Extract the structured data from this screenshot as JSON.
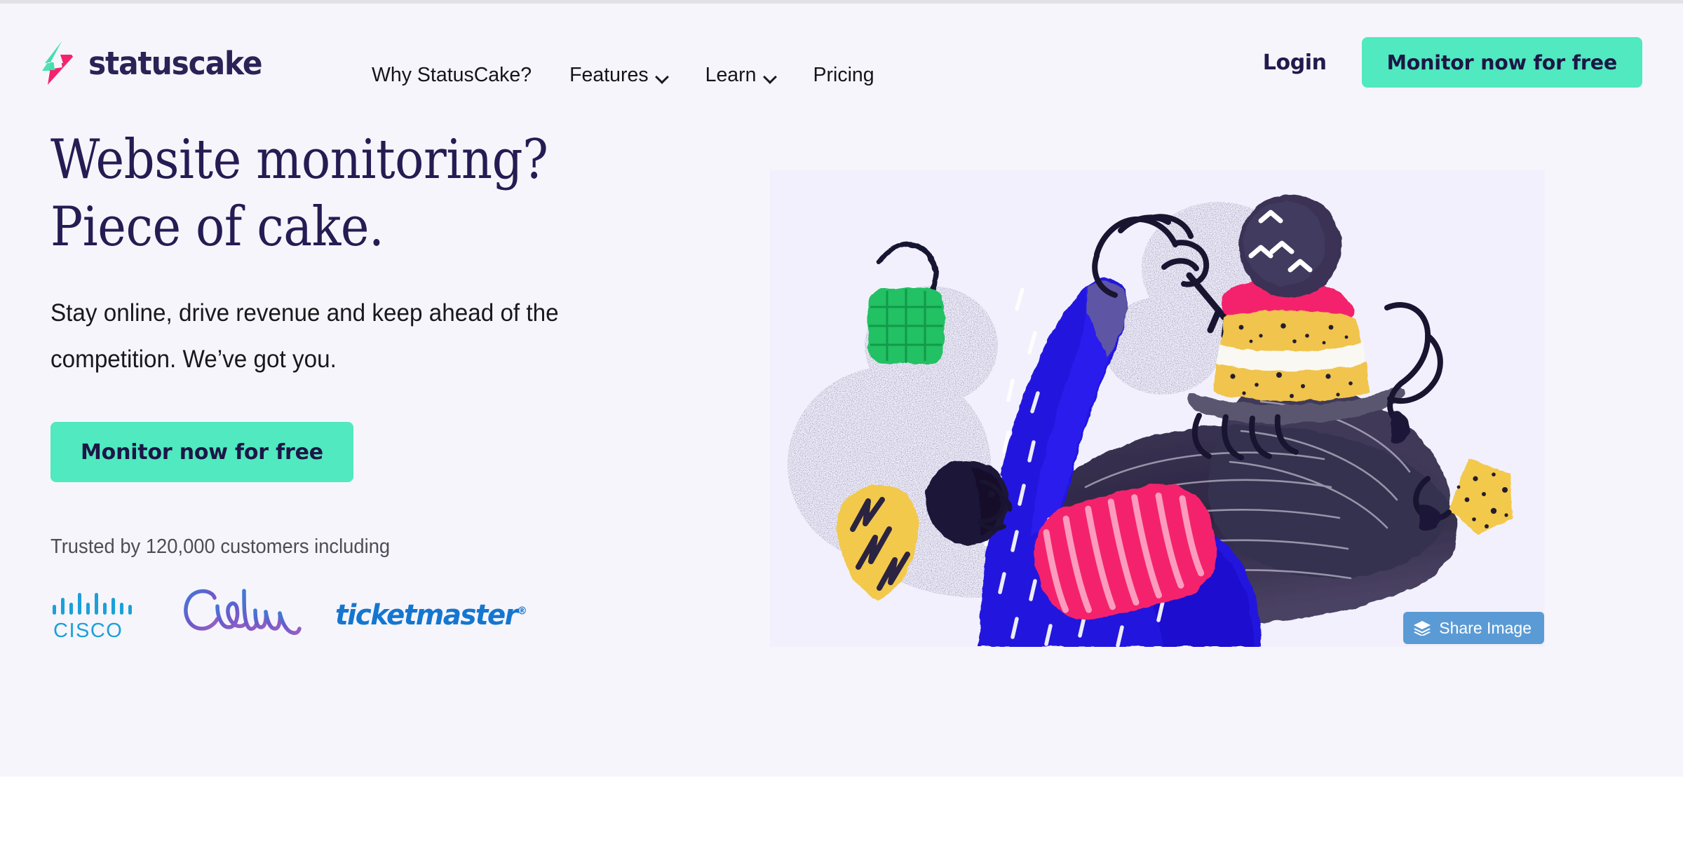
{
  "brand": {
    "name": "statuscake",
    "logo_icon": "lightning-bolt-icon",
    "logo_colors": {
      "top": "#4EE2B0",
      "bottom": "#F4246C"
    }
  },
  "nav": {
    "items": [
      {
        "label": "Why StatusCake?",
        "has_dropdown": false
      },
      {
        "label": "Features",
        "has_dropdown": true
      },
      {
        "label": "Learn",
        "has_dropdown": true
      },
      {
        "label": "Pricing",
        "has_dropdown": false
      }
    ]
  },
  "header": {
    "login_label": "Login",
    "cta_label": "Monitor now for free"
  },
  "hero": {
    "title_line1": "Website monitoring?",
    "title_line2": "Piece of cake.",
    "subtitle": "Stay online, drive revenue and keep ahead of the competition. We’ve got you.",
    "cta_label": "Monitor now for free",
    "trusted_text": "Trusted by 120,000 customers including",
    "logos": [
      {
        "name": "cisco",
        "label": "CISCO"
      },
      {
        "name": "calm",
        "label": "Calm"
      },
      {
        "name": "ticketmaster",
        "label": "ticketmaster",
        "mark": "®"
      }
    ]
  },
  "illustration": {
    "alt": "Person in blue reaching for a slice of layered cake held on a plate, surrounded by colourful abstract shapes",
    "share_button_label": "Share Image",
    "share_button_icon": "layers-stack-icon"
  },
  "colors": {
    "hero_background": "#F6F5FB",
    "illustration_background": "#F2F0FC",
    "accent_mint": "#51E9BF",
    "brand_navy": "#251C53",
    "share_blue": "#5B9BD5",
    "page_background": "#FFFFFF"
  }
}
